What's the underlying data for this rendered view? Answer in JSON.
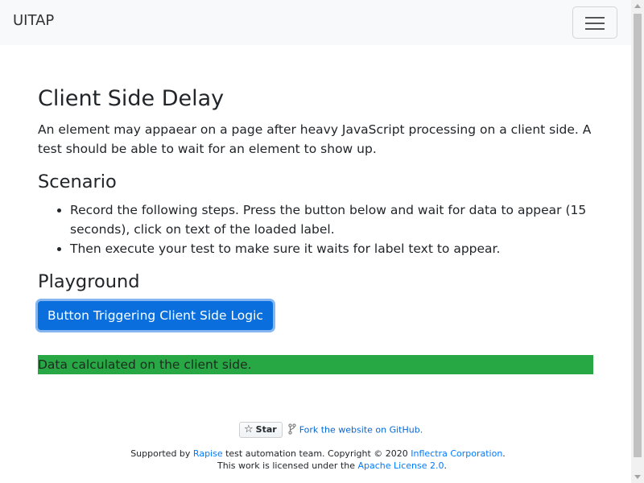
{
  "navbar": {
    "brand": "UITAP"
  },
  "main": {
    "title": "Client Side Delay",
    "intro": "An element may appaear on a page after heavy JavaScript processing on a client side. A test should be able to wait for an element to show up.",
    "scenario_heading": "Scenario",
    "steps": [
      "Record the following steps. Press the button below and wait for data to appear (15 seconds), click on text of the loaded label.",
      "Then execute your test to make sure it waits for label text to appear."
    ],
    "playground_heading": "Playground",
    "button_label": "Button Triggering Client Side Logic",
    "result_text": "Data calculated on the client side."
  },
  "footer": {
    "star_label": "Star",
    "fork_link": "Fork the website on GitHub",
    "fork_suffix": ".",
    "support_prefix": "Supported by ",
    "support_link": "Rapise",
    "support_middle": " test automation team. Copyright © 2020 ",
    "company_link": "Inflectra Corporation",
    "support_suffix": ".",
    "license_prefix": "This work is licensed under the ",
    "license_link": "Apache License 2.0",
    "license_suffix": "."
  },
  "colors": {
    "primary_button": "#0a6fdc",
    "result_background": "#28a745",
    "link": "#007bff"
  },
  "icons": [
    "hamburger-icon",
    "star-icon",
    "fork-icon"
  ]
}
